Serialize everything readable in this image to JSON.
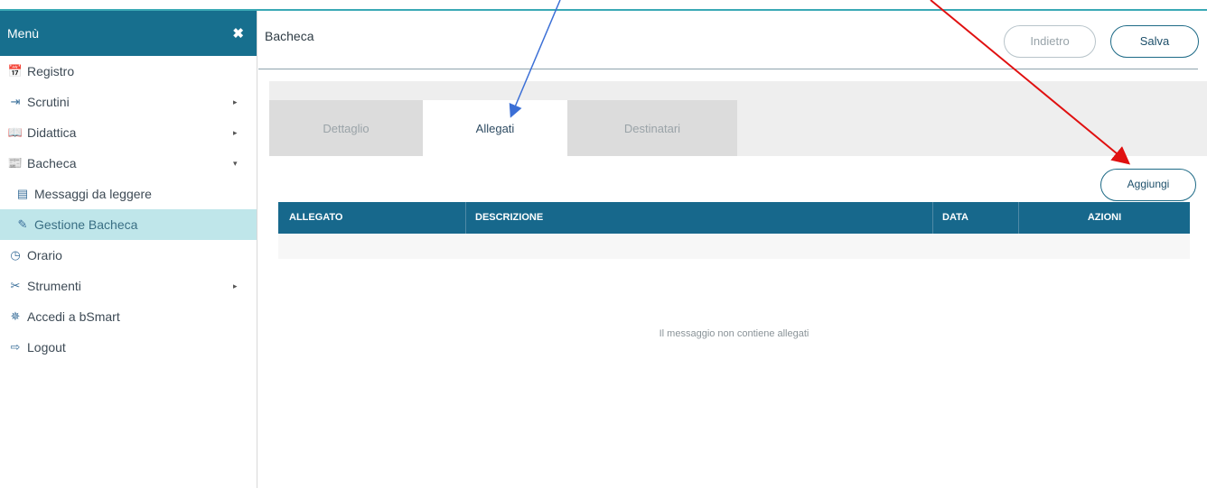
{
  "sidebar": {
    "menu_label": "Menù",
    "close_glyph": "✖",
    "items": [
      {
        "label": "Registro",
        "icon": "calendar-icon",
        "glyph": "📅"
      },
      {
        "label": "Scrutini",
        "icon": "export-icon",
        "glyph": "⇥",
        "arrow": "▸"
      },
      {
        "label": "Didattica",
        "icon": "book-icon",
        "glyph": "📖",
        "arrow": "▸"
      },
      {
        "label": "Bacheca",
        "icon": "bulletin-icon",
        "glyph": "📰",
        "arrow": "▾"
      },
      {
        "label": "Messaggi da leggere",
        "icon": "newspaper-icon",
        "glyph": "▤"
      },
      {
        "label": "Gestione Bacheca",
        "icon": "edit-icon",
        "glyph": "✎"
      },
      {
        "label": "Orario",
        "icon": "clock-icon",
        "glyph": "◷"
      },
      {
        "label": "Strumenti",
        "icon": "tools-icon",
        "glyph": "✂",
        "arrow": "▸"
      },
      {
        "label": "Accedi a bSmart",
        "icon": "gear-icon",
        "glyph": "✵"
      },
      {
        "label": "Logout",
        "icon": "logout-icon",
        "glyph": "⇨"
      }
    ]
  },
  "header": {
    "title": "Bacheca",
    "back_label": "Indietro",
    "save_label": "Salva"
  },
  "tabs": [
    {
      "label": "Dettaglio"
    },
    {
      "label": "Allegati"
    },
    {
      "label": "Destinatari"
    }
  ],
  "add_label": "Aggiungi",
  "table": {
    "columns": [
      "ALLEGATO",
      "DESCRIZIONE",
      "DATA",
      "AZIONI"
    ],
    "empty_message": "Il messaggio non contiene allegati"
  },
  "colors": {
    "accent": "#176f8e",
    "active_item_bg": "#bfe6ea",
    "annotation_blue": "#3b6fd6",
    "annotation_red": "#e01010"
  }
}
